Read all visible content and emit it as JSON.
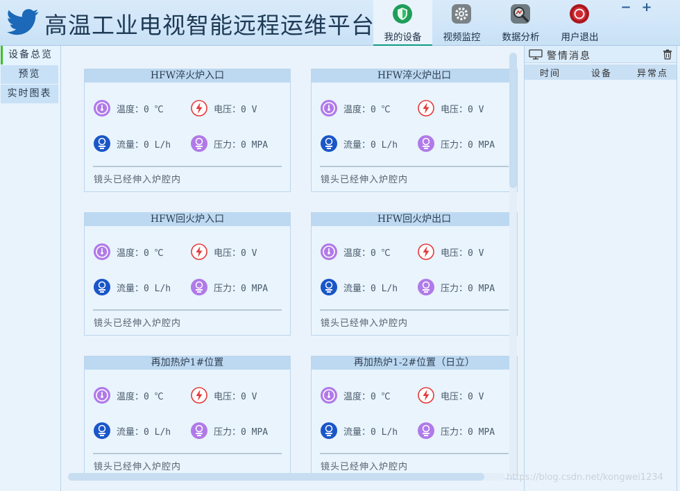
{
  "app": {
    "title": "高温工业电视智能远程运维平台"
  },
  "nav": [
    {
      "label": "我的设备",
      "icon": "shield-icon",
      "active": true
    },
    {
      "label": "视频监控",
      "icon": "gear-icon",
      "active": false
    },
    {
      "label": "数据分析",
      "icon": "magnifier-icon",
      "active": false
    },
    {
      "label": "用户退出",
      "icon": "power-icon",
      "active": false
    }
  ],
  "window_controls": {
    "minimize": "−",
    "maximize": "+"
  },
  "sidebar": {
    "items": [
      {
        "label": "设备总览",
        "active": true
      },
      {
        "label": "预览",
        "active": false
      },
      {
        "label": "实时图表",
        "active": false
      }
    ]
  },
  "devices": [
    {
      "title": "HFW淬火炉入口",
      "temp": "温度：0 ℃",
      "voltage": "电压：0 V",
      "flow": "流量：0 L/h",
      "pressure": "压力：0 MPA",
      "status": "镜头已经伸入炉腔内"
    },
    {
      "title": "HFW淬火炉出口",
      "temp": "温度：0 ℃",
      "voltage": "电压：0 V",
      "flow": "流量：0 L/h",
      "pressure": "压力：0 MPA",
      "status": "镜头已经伸入炉腔内"
    },
    {
      "title": "HFW回火炉入口",
      "temp": "温度：0 ℃",
      "voltage": "电压：0 V",
      "flow": "流量：0 L/h",
      "pressure": "压力：0 MPA",
      "status": "镜头已经伸入炉腔内"
    },
    {
      "title": "HFW回火炉出口",
      "temp": "温度：0 ℃",
      "voltage": "电压：0 V",
      "flow": "流量：0 L/h",
      "pressure": "压力：0 MPA",
      "status": "镜头已经伸入炉腔内"
    },
    {
      "title": "再加热炉1#位置",
      "temp": "温度：0 ℃",
      "voltage": "电压：0 V",
      "flow": "流量：0 L/h",
      "pressure": "压力：0 MPA",
      "status": "镜头已经伸入炉腔内"
    },
    {
      "title": "再加热炉1-2#位置（日立）",
      "temp": "温度：0 ℃",
      "voltage": "电压：0 V",
      "flow": "流量：0 L/h",
      "pressure": "压力：0 MPA",
      "status": "镜头已经伸入炉腔内"
    }
  ],
  "alerts": {
    "title": "警情消息",
    "columns": [
      "时间",
      "设备",
      "异常点"
    ]
  },
  "watermark": "https://blog.csdn.net/kongwei1234",
  "colors": {
    "temp_icon": "#b07ae8",
    "voltage_icon": "#e53838",
    "flow_icon": "#1a56c8",
    "pressure_icon": "#b07ae8",
    "active_tab": "#0f9a86",
    "sidebar_active": "#3fbf2a"
  }
}
